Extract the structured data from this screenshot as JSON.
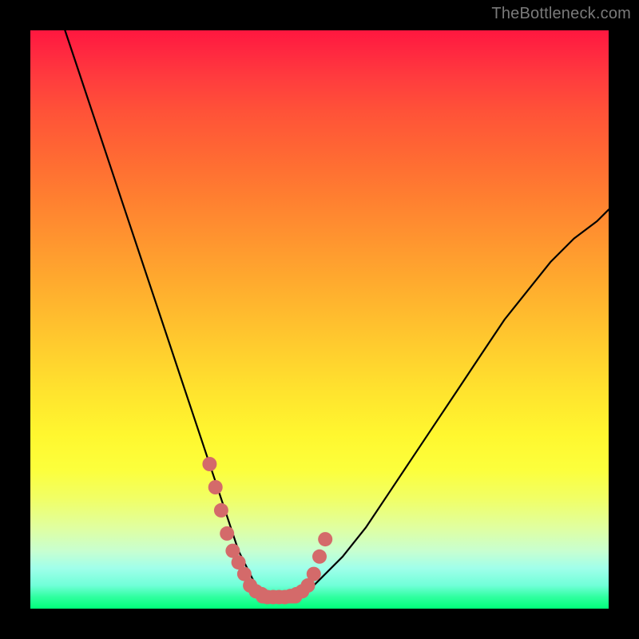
{
  "watermark": "TheBottleneck.com",
  "chart_data": {
    "type": "line",
    "title": "",
    "xlabel": "",
    "ylabel": "",
    "xlim": [
      0,
      100
    ],
    "ylim": [
      0,
      100
    ],
    "grid": false,
    "series": [
      {
        "name": "bottleneck-curve",
        "x": [
          6,
          8,
          10,
          12,
          14,
          16,
          18,
          20,
          22,
          24,
          26,
          28,
          30,
          31,
          32,
          33,
          34,
          35,
          36,
          37,
          38,
          39,
          40,
          41,
          42,
          44,
          46,
          48,
          50,
          54,
          58,
          62,
          66,
          70,
          74,
          78,
          82,
          86,
          90,
          94,
          98,
          100
        ],
        "y": [
          100,
          94,
          88,
          82,
          76,
          70,
          64,
          58,
          52,
          46,
          40,
          34,
          28,
          25,
          22,
          19,
          16,
          13,
          10,
          8,
          6,
          4,
          3,
          2,
          2,
          2,
          2,
          3,
          5,
          9,
          14,
          20,
          26,
          32,
          38,
          44,
          50,
          55,
          60,
          64,
          67,
          69
        ]
      }
    ],
    "markers": {
      "name": "highlight-dots",
      "x": [
        31,
        32,
        33,
        34,
        35,
        36,
        37,
        38,
        39,
        40,
        41,
        42,
        43,
        44,
        45,
        46,
        47,
        48,
        49,
        50,
        51
      ],
      "y": [
        25,
        21,
        17,
        13,
        10,
        8,
        6,
        4,
        3,
        2.5,
        2,
        2,
        2,
        2,
        2.2,
        2.5,
        3,
        4,
        6,
        9,
        12
      ]
    }
  }
}
